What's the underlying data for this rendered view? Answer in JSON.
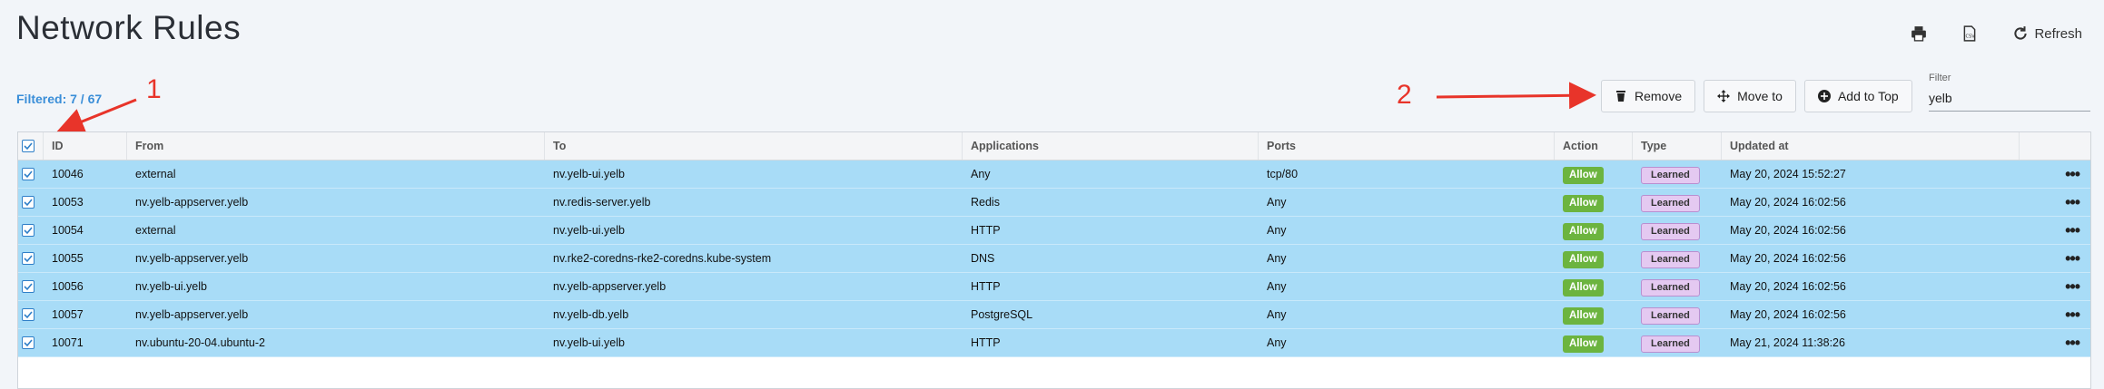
{
  "page": {
    "title": "Network Rules",
    "filtered_text": "Filtered: 7 / 67"
  },
  "top_actions": {
    "print_icon": "printer-icon",
    "export_icon": "csv-export-icon",
    "refresh_label": "Refresh"
  },
  "annotations": {
    "one": "1",
    "two": "2",
    "color": "#e8342a"
  },
  "toolbar": {
    "remove_label": "Remove",
    "move_label": "Move to",
    "add_top_label": "Add to Top"
  },
  "filter": {
    "label": "Filter",
    "value": "yelb"
  },
  "table": {
    "headers": {
      "id": "ID",
      "from": "From",
      "to": "To",
      "applications": "Applications",
      "ports": "Ports",
      "action": "Action",
      "type": "Type",
      "updated": "Updated at"
    },
    "rows": [
      {
        "id": "10046",
        "from": "external",
        "to": "nv.yelb-ui.yelb",
        "app": "Any",
        "ports": "tcp/80",
        "action": "Allow",
        "type": "Learned",
        "updated": "May 20, 2024 15:52:27"
      },
      {
        "id": "10053",
        "from": "nv.yelb-appserver.yelb",
        "to": "nv.redis-server.yelb",
        "app": "Redis",
        "ports": "Any",
        "action": "Allow",
        "type": "Learned",
        "updated": "May 20, 2024 16:02:56"
      },
      {
        "id": "10054",
        "from": "external",
        "to": "nv.yelb-ui.yelb",
        "app": "HTTP",
        "ports": "Any",
        "action": "Allow",
        "type": "Learned",
        "updated": "May 20, 2024 16:02:56"
      },
      {
        "id": "10055",
        "from": "nv.yelb-appserver.yelb",
        "to": "nv.rke2-coredns-rke2-coredns.kube-system",
        "app": "DNS",
        "ports": "Any",
        "action": "Allow",
        "type": "Learned",
        "updated": "May 20, 2024 16:02:56"
      },
      {
        "id": "10056",
        "from": "nv.yelb-ui.yelb",
        "to": "nv.yelb-appserver.yelb",
        "app": "HTTP",
        "ports": "Any",
        "action": "Allow",
        "type": "Learned",
        "updated": "May 20, 2024 16:02:56"
      },
      {
        "id": "10057",
        "from": "nv.yelb-appserver.yelb",
        "to": "nv.yelb-db.yelb",
        "app": "PostgreSQL",
        "ports": "Any",
        "action": "Allow",
        "type": "Learned",
        "updated": "May 20, 2024 16:02:56"
      },
      {
        "id": "10071",
        "from": "nv.ubuntu-20-04.ubuntu-2",
        "to": "nv.yelb-ui.yelb",
        "app": "HTTP",
        "ports": "Any",
        "action": "Allow",
        "type": "Learned",
        "updated": "May 21, 2024 11:38:26"
      }
    ]
  },
  "colors": {
    "row_selected": "#a8dcf7",
    "allow_badge": "#6cb43f",
    "learned_badge": "#e4c9f1",
    "accent": "#3a8ed8"
  }
}
